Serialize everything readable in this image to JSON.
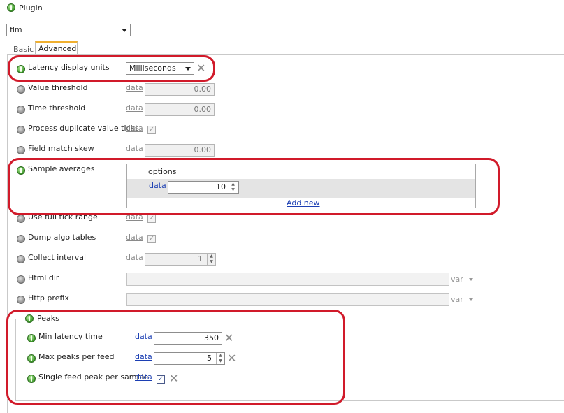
{
  "header": {
    "title": "Plugin",
    "plugin_select_value": "flm"
  },
  "tabs": [
    {
      "label": "Basic"
    },
    {
      "label": "Advanced"
    }
  ],
  "rows": {
    "latency_units": {
      "label": "Latency display units",
      "value": "Milliseconds"
    },
    "value_threshold": {
      "label": "Value threshold",
      "link": "data",
      "value": "0.00"
    },
    "time_threshold": {
      "label": "Time threshold",
      "link": "data",
      "value": "0.00"
    },
    "process_duplicate": {
      "label": "Process duplicate value ticks",
      "link": "data",
      "checked": "✓"
    },
    "field_match_skew": {
      "label": "Field match skew",
      "link": "data",
      "value": "0.00"
    },
    "sample_averages": {
      "label": "Sample averages",
      "header": "options",
      "link": "data",
      "value": "10",
      "add_new": "Add new"
    },
    "use_full_tick_range": {
      "label": "Use full tick range",
      "link": "data",
      "checked": "✓"
    },
    "dump_algo_tables": {
      "label": "Dump algo tables",
      "link": "data",
      "checked": "✓"
    },
    "collect_interval": {
      "label": "Collect interval",
      "link": "data",
      "value": "1"
    },
    "html_dir": {
      "label": "Html dir",
      "var": "var"
    },
    "http_prefix": {
      "label": "Http prefix",
      "var": "var"
    }
  },
  "peaks": {
    "title": "Peaks",
    "min_latency": {
      "label": "Min latency time",
      "link": "data",
      "value": "350"
    },
    "max_peaks": {
      "label": "Max peaks per feed",
      "link": "data",
      "value": "5"
    },
    "single_feed": {
      "label": "Single feed peak per sample",
      "link": "data",
      "checked": "✓"
    }
  },
  "colors": {
    "annotation_red": "#d11a2a",
    "link_blue": "#1c3fb3",
    "status_green": "#3e9a2a"
  }
}
